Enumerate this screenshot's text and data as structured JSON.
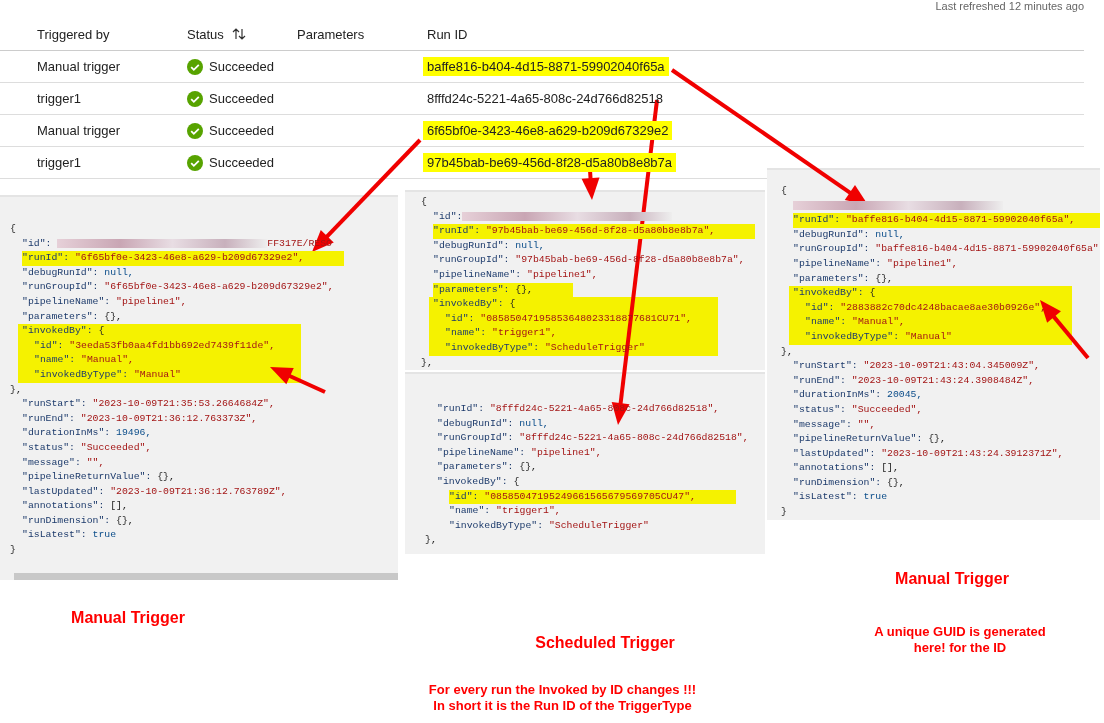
{
  "header": {
    "last_refreshed": "Last refreshed 12 minutes ago"
  },
  "table": {
    "columns": [
      {
        "label": "Triggered by",
        "sortable": false
      },
      {
        "label": "Status",
        "sortable": true
      },
      {
        "label": "Parameters",
        "sortable": false
      },
      {
        "label": "Run ID",
        "sortable": false
      }
    ],
    "rows": [
      {
        "triggered_by": "Manual trigger",
        "status": "Succeeded",
        "run_id": "baffe816-b404-4d15-8871-59902040f65a",
        "highlighted": true
      },
      {
        "triggered_by": "trigger1",
        "status": "Succeeded",
        "run_id": "8fffd24c-5221-4a65-808c-24d766d82518",
        "highlighted": false
      },
      {
        "triggered_by": "Manual trigger",
        "status": "Succeeded",
        "run_id": "6f65bf0e-3423-46e8-a629-b209d67329e2",
        "highlighted": true
      },
      {
        "triggered_by": "trigger1",
        "status": "Succeeded",
        "run_id": "97b45bab-be69-456d-8f28-d5a80b8e8b7a",
        "highlighted": true
      }
    ]
  },
  "json_panels": [
    {
      "lines": [
        {
          "value": "{",
          "kind": "punct",
          "highlighted": false
        },
        {
          "key": "\"id\": ",
          "redacted": true,
          "value": "FF317E/RESO",
          "kind": "string",
          "highlighted": false
        },
        {
          "key": "\"runId\": ",
          "value": "\"6f65bf0e-3423-46e8-a629-b209d67329e2\",",
          "kind": "string",
          "highlighted": true
        },
        {
          "key": "\"debugRunId\": ",
          "value": "null,",
          "kind": "literal",
          "highlighted": false
        },
        {
          "key": "\"runGroupId\": ",
          "value": "\"6f65bf0e-3423-46e8-a629-b209d67329e2\",",
          "kind": "string",
          "highlighted": false
        },
        {
          "key": "\"pipelineName\": ",
          "value": "\"pipeline1\",",
          "kind": "string",
          "highlighted": false
        },
        {
          "key": "\"parameters\": ",
          "value": "{},",
          "kind": "punct",
          "highlighted": false
        },
        {
          "key": "\"invokedBy\": ",
          "value": "{",
          "kind": "punct",
          "highlighted": true,
          "children": [
            {
              "key": "\"id\": ",
              "value": "\"3eeda53fb0aa4fd1bb692ed7439f11de\",",
              "kind": "string",
              "highlighted": false
            },
            {
              "key": "\"name\": ",
              "value": "\"Manual\",",
              "kind": "string",
              "highlighted": false
            },
            {
              "key": "\"invokedByType\": ",
              "value": "\"Manual\"",
              "kind": "string",
              "highlighted": false
            }
          ]
        },
        {
          "value": "},",
          "kind": "punct",
          "highlighted": false
        },
        {
          "key": "\"runStart\": ",
          "value": "\"2023-10-09T21:35:53.2664684Z\",",
          "kind": "string",
          "highlighted": false
        },
        {
          "key": "\"runEnd\": ",
          "value": "\"2023-10-09T21:36:12.763373Z\",",
          "kind": "string",
          "highlighted": false
        },
        {
          "key": "\"durationInMs\": ",
          "value": "19496,",
          "kind": "literal",
          "highlighted": false
        },
        {
          "key": "\"status\": ",
          "value": "\"Succeeded\",",
          "kind": "string",
          "highlighted": false
        },
        {
          "key": "\"message\": ",
          "value": "\"\",",
          "kind": "string",
          "highlighted": false
        },
        {
          "key": "\"pipelineReturnValue\": ",
          "value": "{},",
          "kind": "punct",
          "highlighted": false
        },
        {
          "key": "\"lastUpdated\": ",
          "value": "\"2023-10-09T21:36:12.763789Z\",",
          "kind": "string",
          "highlighted": false
        },
        {
          "key": "\"annotations\": ",
          "value": "[],",
          "kind": "punct",
          "highlighted": false
        },
        {
          "key": "\"runDimension\": ",
          "value": "{},",
          "kind": "punct",
          "highlighted": false
        },
        {
          "key": "\"isLatest\": ",
          "value": "true",
          "kind": "literal",
          "highlighted": false
        },
        {
          "value": "}",
          "kind": "punct",
          "highlighted": false
        }
      ]
    },
    {
      "lines": [
        {
          "value": "{",
          "kind": "punct",
          "highlighted": false
        },
        {
          "key": "\"id\":",
          "redacted": true,
          "highlighted": false
        },
        {
          "key": "\"runId\": ",
          "value": "\"97b45bab-be69-456d-8f28-d5a80b8e8b7a\",",
          "kind": "string",
          "highlighted": true
        },
        {
          "key": "\"debugRunId\": ",
          "value": "null,",
          "kind": "literal",
          "highlighted": false
        },
        {
          "key": "\"runGroupId\": ",
          "value": "\"97b45bab-be69-456d-8f28-d5a80b8e8b7a\",",
          "kind": "string",
          "highlighted": false
        },
        {
          "key": "\"pipelineName\": ",
          "value": "\"pipeline1\",",
          "kind": "string",
          "highlighted": false
        },
        {
          "key": "\"parameters\": ",
          "value": "{},",
          "kind": "punct",
          "highlighted": true
        },
        {
          "key": "\"invokedBy\": ",
          "value": "{",
          "kind": "punct",
          "highlighted": true,
          "children": [
            {
              "key": "\"id\": ",
              "value": "\"08585047195853648023318877681CU71\",",
              "kind": "string",
              "highlighted": false
            },
            {
              "key": "\"name\": ",
              "value": "\"trigger1\",",
              "kind": "string",
              "highlighted": false
            },
            {
              "key": "\"invokedByType\": ",
              "value": "\"ScheduleTrigger\"",
              "kind": "string",
              "highlighted": false
            }
          ]
        },
        {
          "value": "},",
          "kind": "punct",
          "highlighted": false
        }
      ]
    },
    {
      "lines": [
        {
          "key": "\"runId\": ",
          "value": "\"8fffd24c-5221-4a65-808c-24d766d82518\",",
          "kind": "string",
          "highlighted": false
        },
        {
          "key": "\"debugRunId\": ",
          "value": "null,",
          "kind": "literal",
          "highlighted": false
        },
        {
          "key": "\"runGroupId\": ",
          "value": "\"8fffd24c-5221-4a65-808c-24d766d82518\",",
          "kind": "string",
          "highlighted": false
        },
        {
          "key": "\"pipelineName\": ",
          "value": "\"pipeline1\",",
          "kind": "string",
          "highlighted": false
        },
        {
          "key": "\"parameters\": ",
          "value": "{},",
          "kind": "punct",
          "highlighted": false
        },
        {
          "key": "\"invokedBy\": ",
          "value": "{",
          "kind": "punct",
          "highlighted": false,
          "children": [
            {
              "key": "\"id\": ",
              "value": "\"08585047195249661565679569705CU47\",",
              "kind": "string",
              "highlighted": true
            },
            {
              "key": "\"name\": ",
              "value": "\"trigger1\",",
              "kind": "string",
              "highlighted": false
            },
            {
              "key": "\"invokedByType\": ",
              "value": "\"ScheduleTrigger\"",
              "kind": "string",
              "highlighted": false
            }
          ]
        },
        {
          "value": "},",
          "kind": "punct",
          "highlighted": false
        }
      ]
    },
    {
      "lines": [
        {
          "value": "{",
          "kind": "punct",
          "highlighted": false
        },
        {
          "redacted": true,
          "highlighted": false
        },
        {
          "key": "\"runId\": ",
          "value": "\"baffe816-b404-4d15-8871-59902040f65a\",",
          "kind": "string",
          "highlighted": true
        },
        {
          "key": "\"debugRunId\": ",
          "value": "null,",
          "kind": "literal",
          "highlighted": false
        },
        {
          "key": "\"runGroupId\": ",
          "value": "\"baffe816-b404-4d15-8871-59902040f65a\"",
          "kind": "string",
          "highlighted": false
        },
        {
          "key": "\"pipelineName\": ",
          "value": "\"pipeline1\",",
          "kind": "string",
          "highlighted": false
        },
        {
          "key": "\"parameters\": ",
          "value": "{},",
          "kind": "punct",
          "highlighted": false
        },
        {
          "key": "\"invokedBy\": ",
          "value": "{",
          "kind": "punct",
          "highlighted": true,
          "children": [
            {
              "key": "\"id\": ",
              "value": "\"2883882c70dc4248bacae8ae30b0926e\",",
              "kind": "string",
              "highlighted": false
            },
            {
              "key": "\"name\": ",
              "value": "\"Manual\",",
              "kind": "string",
              "highlighted": false
            },
            {
              "key": "\"invokedByType\": ",
              "value": "\"Manual\"",
              "kind": "string",
              "highlighted": false
            }
          ]
        },
        {
          "value": "},",
          "kind": "punct",
          "highlighted": false
        },
        {
          "key": "\"runStart\": ",
          "value": "\"2023-10-09T21:43:04.345009Z\",",
          "kind": "string",
          "highlighted": false
        },
        {
          "key": "\"runEnd\": ",
          "value": "\"2023-10-09T21:43:24.3908484Z\",",
          "kind": "string",
          "highlighted": false
        },
        {
          "key": "\"durationInMs\": ",
          "value": "20045,",
          "kind": "literal",
          "highlighted": false
        },
        {
          "key": "\"status\": ",
          "value": "\"Succeeded\",",
          "kind": "string",
          "highlighted": false
        },
        {
          "key": "\"message\": ",
          "value": "\"\",",
          "kind": "string",
          "highlighted": false
        },
        {
          "key": "\"pipelineReturnValue\": ",
          "value": "{},",
          "kind": "punct",
          "highlighted": false
        },
        {
          "key": "\"lastUpdated\": ",
          "value": "\"2023-10-09T21:43:24.3912371Z\",",
          "kind": "string",
          "highlighted": false
        },
        {
          "key": "\"annotations\": ",
          "value": "[],",
          "kind": "punct",
          "highlighted": false
        },
        {
          "key": "\"runDimension\": ",
          "value": "{},",
          "kind": "punct",
          "highlighted": false
        },
        {
          "key": "\"isLatest\": ",
          "value": "true",
          "kind": "literal",
          "highlighted": false
        },
        {
          "value": "}",
          "kind": "punct",
          "highlighted": false
        }
      ]
    }
  ],
  "annotations": [
    {
      "kind": "title",
      "text": "Manual Trigger"
    },
    {
      "kind": "title",
      "text": "Scheduled Trigger"
    },
    {
      "kind": "note",
      "text": "For every run the Invoked by ID changes !!!\nIn short it is the Run ID of the TriggerType"
    },
    {
      "kind": "title",
      "text": "Manual Trigger"
    },
    {
      "kind": "note",
      "text": "A unique GUID is generated\nhere! for the ID"
    }
  ]
}
